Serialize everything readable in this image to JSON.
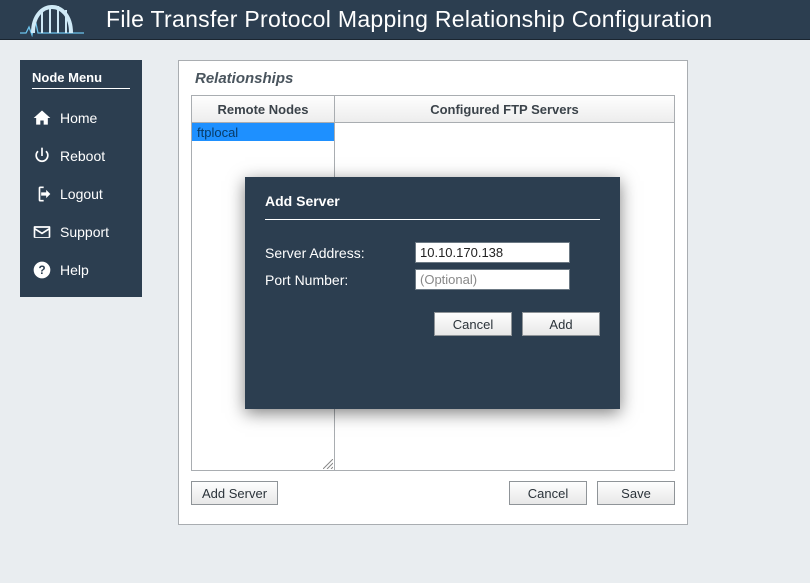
{
  "header": {
    "title": "File Transfer Protocol Mapping Relationship Configuration"
  },
  "sidebar": {
    "title": "Node Menu",
    "items": [
      {
        "label": "Home"
      },
      {
        "label": "Reboot"
      },
      {
        "label": "Logout"
      },
      {
        "label": "Support"
      },
      {
        "label": "Help"
      }
    ]
  },
  "panel": {
    "title": "Relationships",
    "left_header": "Remote Nodes",
    "right_header": "Configured FTP Servers",
    "remote_nodes": [
      "ftplocal"
    ],
    "buttons": {
      "add_server": "Add Server",
      "cancel": "Cancel",
      "save": "Save"
    }
  },
  "modal": {
    "title": "Add Server",
    "labels": {
      "server_address": "Server Address:",
      "port_number": "Port Number:"
    },
    "values": {
      "server_address": "10.10.170.138",
      "port_number": ""
    },
    "placeholders": {
      "port_number": "(Optional)"
    },
    "buttons": {
      "cancel": "Cancel",
      "add": "Add"
    }
  }
}
